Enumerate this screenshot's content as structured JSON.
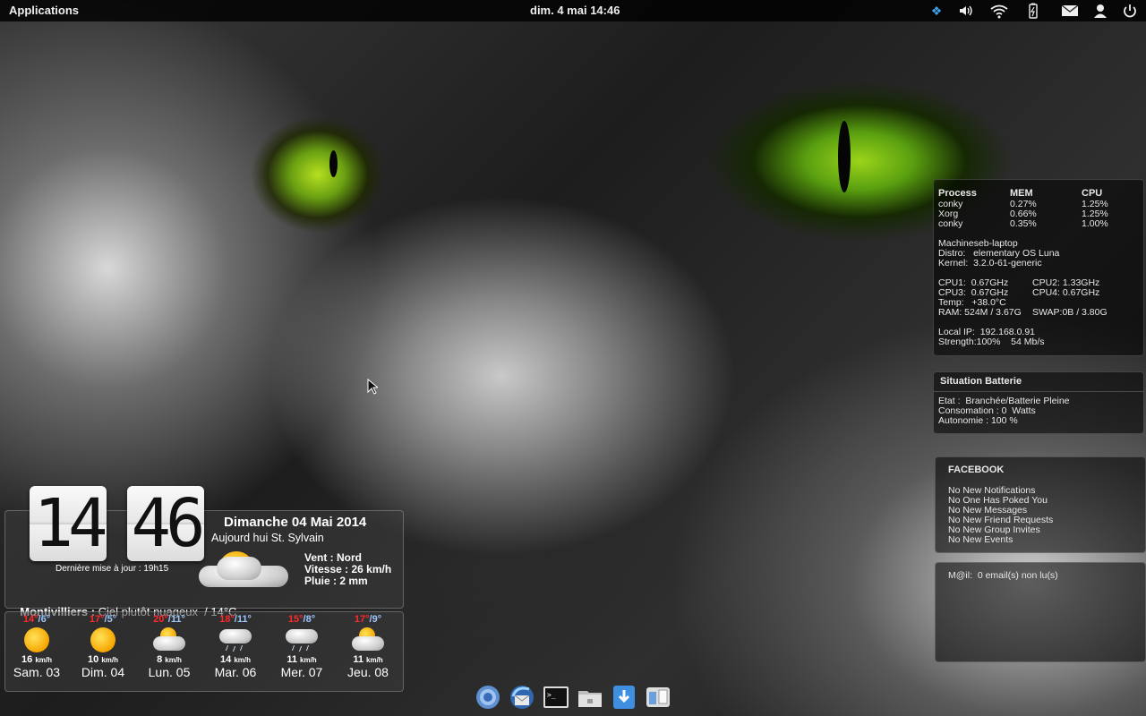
{
  "top_panel": {
    "apps_menu": "Applications",
    "clock": "dim.  4 mai 14:46",
    "tray_icons": [
      "dropbox-icon",
      "volume-icon",
      "wifi-icon",
      "battery-icon",
      "mail-icon",
      "user-icon",
      "power-icon"
    ]
  },
  "conky_process": {
    "headers": {
      "process": "Process",
      "mem": "MEM",
      "cpu": "CPU"
    },
    "rows": [
      {
        "name": "conky",
        "mem": "0.27%",
        "cpu": "1.25%"
      },
      {
        "name": "Xorg",
        "mem": "0.66%",
        "cpu": "1.25%"
      },
      {
        "name": "conky",
        "mem": "0.35%",
        "cpu": "1.00%"
      }
    ],
    "hostname": "Machineseb-laptop",
    "distro": "Distro:   elementary OS Luna",
    "kernel": "Kernel:  3.2.0-61-generic",
    "cpu1": "CPU1:  0.67GHz",
    "cpu2": "CPU2: 1.33GHz",
    "cpu3": "CPU3:  0.67GHz",
    "cpu4": "CPU4: 0.67GHz",
    "temp": "Temp:   +38.0°C",
    "ram": "RAM: 524M / 3.67G",
    "swap": "SWAP:0B / 3.80G",
    "local_ip": "Local IP:  192.168.0.91",
    "strength": "Strength:100%    54 Mb/s"
  },
  "battery": {
    "title": "Situation Batterie",
    "etat": "Etat :  Branchée/Batterie Pleine",
    "consumption": "Consomation : 0  Watts",
    "autonomy": "Autonomie : 100 %"
  },
  "facebook": {
    "title": "FACEBOOK",
    "items": [
      "No New Notifications",
      "No One Has Poked You",
      "No New Messages",
      "No New Friend Requests",
      "No New Group Invites",
      "No New Events"
    ]
  },
  "mail": {
    "text": "M@il:  0 email(s) non lu(s)"
  },
  "weather": {
    "hour": "14",
    "minute": "46",
    "last_update": "Dernière mise à jour : 19h15",
    "date": "Dimanche 04 Mai 2014",
    "saint": "Aujourd hui St.  Sylvain",
    "wind": "Vent : Nord",
    "speed": "Vitesse : 26 km/h",
    "rain": "Pluie : 2 mm",
    "location": "Montivilliers :",
    "condition": " Ciel plutôt nuageux  / 14°C",
    "forecast": [
      {
        "hi": "14°",
        "lo": "/6°",
        "wind": "16",
        "unit": "km/h",
        "day": "Sam. 03",
        "icon": "sun-icon"
      },
      {
        "hi": "17°",
        "lo": "/5°",
        "wind": "10",
        "unit": "km/h",
        "day": "Dim. 04",
        "icon": "sun-icon"
      },
      {
        "hi": "20°",
        "lo": "/11°",
        "wind": "8",
        "unit": "km/h",
        "day": "Lun. 05",
        "icon": "cloudy-sun-icon"
      },
      {
        "hi": "18°",
        "lo": "/11°",
        "wind": "14",
        "unit": "km/h",
        "day": "Mar. 06",
        "icon": "rain-cloud-icon"
      },
      {
        "hi": "15°",
        "lo": "/8°",
        "wind": "11",
        "unit": "km/h",
        "day": "Mer. 07",
        "icon": "rain-cloud-icon"
      },
      {
        "hi": "17°",
        "lo": "/9°",
        "wind": "11",
        "unit": "km/h",
        "day": "Jeu. 08",
        "icon": "cloudy-sun-icon"
      }
    ]
  },
  "dock": {
    "icons": [
      "chromium-icon",
      "thunderbird-icon",
      "terminal-icon",
      "files-icon",
      "downloads-icon",
      "switchboard-icon"
    ]
  }
}
